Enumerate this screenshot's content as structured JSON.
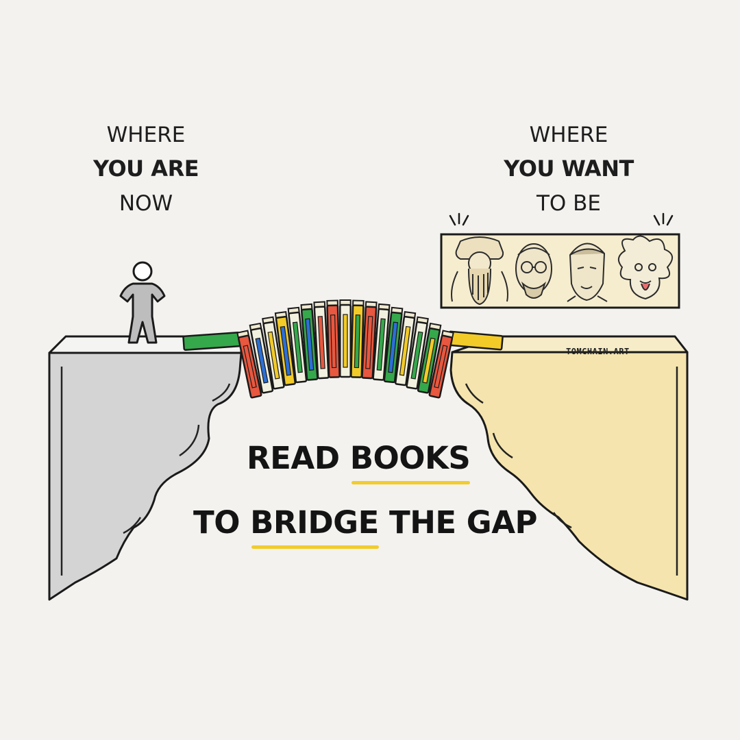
{
  "left_label": {
    "line1": "WHERE",
    "line2": "YOU ARE",
    "line3": "NOW"
  },
  "right_label": {
    "line1": "WHERE",
    "line2": "YOU WANT",
    "line3": "TO BE"
  },
  "headline": {
    "line1_a": "READ ",
    "line1_b": "BOOKS",
    "line2_a": "TO ",
    "line2_b": "BRIDGE",
    "line2_c": " THE GAP"
  },
  "credit": "TOMCHAIN.ART",
  "colors": {
    "left_cliff": "#d4d4d4",
    "right_cliff": "#f5e4ad",
    "underline": "#f1cc2c",
    "book_red": "#e8573f",
    "book_blue": "#2c6fd6",
    "book_green": "#35a84b",
    "book_yellow": "#f3cb28",
    "book_pale": "#f2f0df"
  },
  "icons": [
    "person-icon",
    "portrait-leonardo-icon",
    "portrait-jobs-icon",
    "portrait-musk-icon",
    "portrait-einstein-icon"
  ]
}
